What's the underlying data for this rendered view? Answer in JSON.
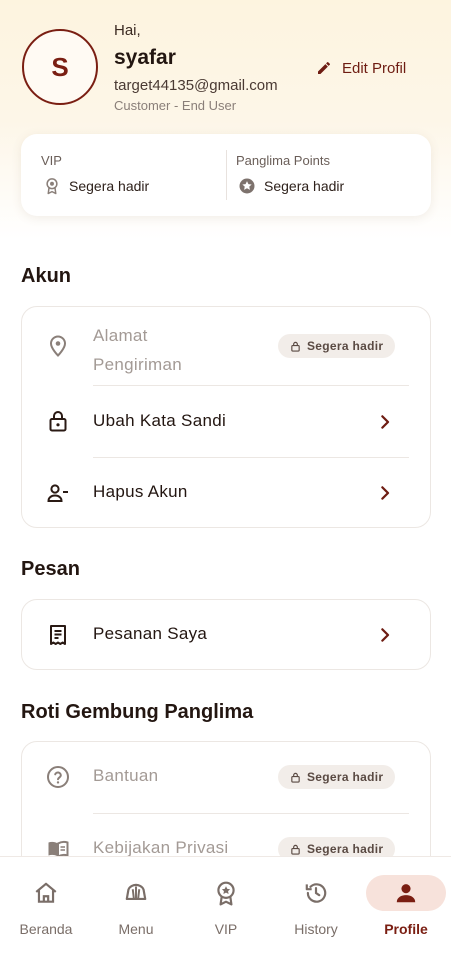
{
  "profile": {
    "greeting": "Hai,",
    "name": "syafar",
    "initial": "S",
    "email": "target44135@gmail.com",
    "role": "Customer - End User",
    "edit_label": "Edit Profil"
  },
  "stats": {
    "vip_label": "VIP",
    "vip_value": "Segera hadir",
    "points_label": "Panglima Points",
    "points_value": "Segera hadir"
  },
  "sections": {
    "account": {
      "title": "Akun",
      "items": [
        {
          "label": "Alamat\nPengiriman",
          "icon": "location-pin-icon",
          "badge": "Segera hadir",
          "disabled": true
        },
        {
          "label": "Ubah Kata Sandi",
          "icon": "lock-icon",
          "disabled": false
        },
        {
          "label": "Hapus Akun",
          "icon": "remove-user-icon",
          "disabled": false
        }
      ]
    },
    "messages": {
      "title": "Pesan",
      "items": [
        {
          "label": "Pesanan Saya",
          "icon": "receipt-icon",
          "disabled": false
        }
      ]
    },
    "brand": {
      "title": "Roti Gembung Panglima",
      "items": [
        {
          "label": "Bantuan",
          "icon": "help-icon",
          "badge": "Segera hadir",
          "disabled": true
        },
        {
          "label": "Kebijakan Privasi",
          "icon": "book-icon",
          "badge": "Segera hadir",
          "disabled": true
        }
      ]
    }
  },
  "nav": {
    "items": [
      {
        "label": "Beranda",
        "icon": "home-icon"
      },
      {
        "label": "Menu",
        "icon": "bread-icon"
      },
      {
        "label": "VIP",
        "icon": "badge-icon"
      },
      {
        "label": "History",
        "icon": "history-icon"
      },
      {
        "label": "Profile",
        "icon": "person-icon"
      }
    ],
    "active": "Profile"
  },
  "colors": {
    "brand": "#7a1e12",
    "active_bg": "#f7e2db",
    "badge_bg": "#f2ede9"
  }
}
